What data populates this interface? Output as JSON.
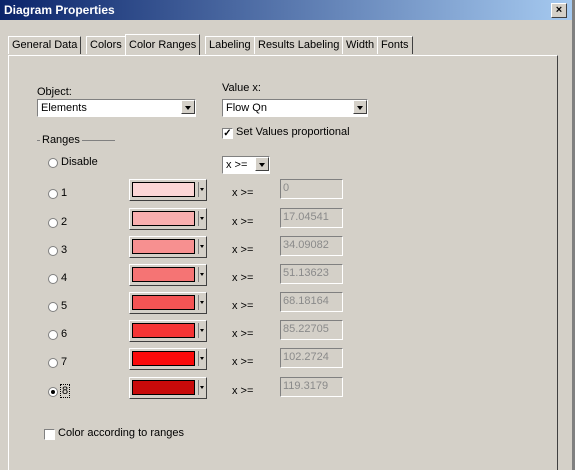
{
  "window": {
    "title": "Diagram Properties",
    "close_label": "×"
  },
  "tabs": [
    {
      "label": "General Data"
    },
    {
      "label": "Colors"
    },
    {
      "label": "Color Ranges"
    },
    {
      "label": "Labeling"
    },
    {
      "label": "Results Labeling"
    },
    {
      "label": "Width"
    },
    {
      "label": "Fonts"
    }
  ],
  "active_tab": "Color Ranges",
  "object": {
    "label": "Object:",
    "value": "Elements"
  },
  "value_x": {
    "label": "Value x:",
    "value": "Flow Qn"
  },
  "set_values_proportional": {
    "label": "Set Values proportional",
    "checked": true,
    "mark": "✓"
  },
  "comparison": {
    "value": "x >="
  },
  "ranges": {
    "title": "Ranges",
    "disable_label": "Disable",
    "selected": "8",
    "items": [
      {
        "label": "1",
        "color": "#fcd6d6",
        "op": "x >=",
        "value": "0"
      },
      {
        "label": "2",
        "color": "#f9aeae",
        "op": "x >=",
        "value": "17.04541"
      },
      {
        "label": "3",
        "color": "#f79090",
        "op": "x >=",
        "value": "34.09082"
      },
      {
        "label": "4",
        "color": "#f57474",
        "op": "x >=",
        "value": "51.13623"
      },
      {
        "label": "5",
        "color": "#f45454",
        "op": "x >=",
        "value": "68.18164"
      },
      {
        "label": "6",
        "color": "#f53434",
        "op": "x >=",
        "value": "85.22705"
      },
      {
        "label": "7",
        "color": "#fa0a0a",
        "op": "x >=",
        "value": "102.2724"
      },
      {
        "label": "8",
        "color": "#c80a0a",
        "op": "x >=",
        "value": "119.3179"
      }
    ]
  },
  "color_according": {
    "label": "Color according to ranges",
    "checked": false
  }
}
